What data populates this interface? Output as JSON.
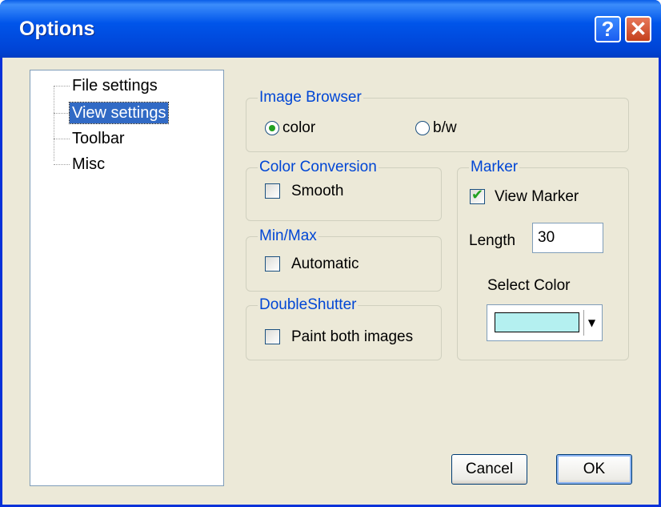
{
  "window": {
    "title": "Options",
    "help_label": "?",
    "close_label": "✕"
  },
  "tree": {
    "items": [
      "File settings",
      "View settings",
      "Toolbar",
      "Misc"
    ],
    "selected": "View settings"
  },
  "image_browser": {
    "title": "Image Browser",
    "options": [
      "color",
      "b/w"
    ],
    "selected": "color"
  },
  "color_conversion": {
    "title": "Color Conversion",
    "checkbox_label": "Smooth",
    "checked": false
  },
  "min_max": {
    "title": "Min/Max",
    "checkbox_label": "Automatic",
    "checked": false
  },
  "double_shutter": {
    "title": "DoubleShutter",
    "checkbox_label": "Paint both images",
    "checked": false
  },
  "marker": {
    "title": "Marker",
    "view_marker_label": "View Marker",
    "view_marker_checked": true,
    "length_label": "Length",
    "length_value": "30",
    "select_color_label": "Select Color",
    "selected_color": "#b4f0f0"
  },
  "buttons": {
    "cancel": "Cancel",
    "ok": "OK"
  },
  "colors": {
    "title_bar": "#0055ea",
    "dialog_bg": "#ece9d8",
    "group_title": "#0046d5",
    "selection": "#316ac5",
    "check_green": "#21a121"
  }
}
